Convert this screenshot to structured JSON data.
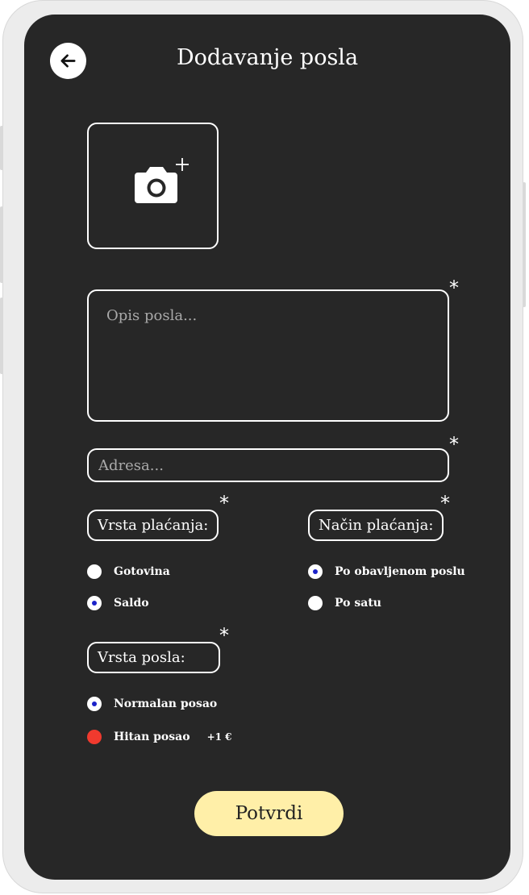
{
  "header": {
    "title": "Dodavanje posla",
    "back_icon": "arrow-left-icon"
  },
  "photo": {
    "icon": "camera-add-icon"
  },
  "required_mark": "*",
  "description": {
    "placeholder": "Opis posla...",
    "value": ""
  },
  "address": {
    "placeholder": "Adresa...",
    "value": ""
  },
  "payment_type": {
    "label": "Vrsta plaćanja:",
    "options": [
      {
        "label": "Gotovina",
        "selected": false
      },
      {
        "label": "Saldo",
        "selected": true
      }
    ]
  },
  "payment_method": {
    "label": "Način plaćanja:",
    "options": [
      {
        "label": "Po obavljenom poslu",
        "selected": true
      },
      {
        "label": "Po satu",
        "selected": false
      }
    ]
  },
  "job_type": {
    "label": "Vrsta posla:",
    "options": [
      {
        "label": "Normalan posao",
        "selected": true
      },
      {
        "label": "Hitan posao",
        "selected": false,
        "extra": "+1 €"
      }
    ]
  },
  "submit_label": "Potvrdi",
  "colors": {
    "screen_bg": "#272727",
    "device_frame": "#ececec",
    "submit_bg": "#ffefa8",
    "radio_selected_dot": "#1b22c9",
    "urgent_red": "#f03a2e"
  }
}
